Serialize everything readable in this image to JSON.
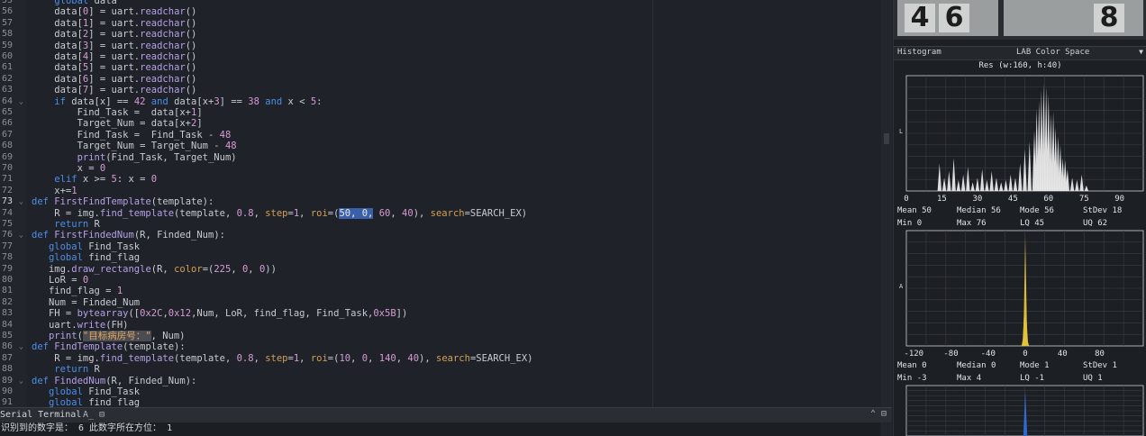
{
  "editor": {
    "current_line": "73",
    "lines": [
      {
        "n": "55",
        "fold": false,
        "html": "    <span class=\"kw\">global</span> data"
      },
      {
        "n": "56",
        "fold": false,
        "html": "    data[<span class=\"num\">0</span>] = uart.<span class=\"fn\">readchar</span>()"
      },
      {
        "n": "57",
        "fold": false,
        "html": "    data[<span class=\"num\">1</span>] = uart.<span class=\"fn\">readchar</span>()"
      },
      {
        "n": "58",
        "fold": false,
        "html": "    data[<span class=\"num\">2</span>] = uart.<span class=\"fn\">readchar</span>()"
      },
      {
        "n": "59",
        "fold": false,
        "html": "    data[<span class=\"num\">3</span>] = uart.<span class=\"fn\">readchar</span>()"
      },
      {
        "n": "60",
        "fold": false,
        "html": "    data[<span class=\"num\">4</span>] = uart.<span class=\"fn\">readchar</span>()"
      },
      {
        "n": "61",
        "fold": false,
        "html": "    data[<span class=\"num\">5</span>] = uart.<span class=\"fn\">readchar</span>()"
      },
      {
        "n": "62",
        "fold": false,
        "html": "    data[<span class=\"num\">6</span>] = uart.<span class=\"fn\">readchar</span>()"
      },
      {
        "n": "63",
        "fold": false,
        "html": "    data[<span class=\"num\">7</span>] = uart.<span class=\"fn\">readchar</span>()"
      },
      {
        "n": "64",
        "fold": true,
        "html": "    <span class=\"kw\">if</span> data[x] == <span class=\"num\">42</span> <span class=\"kw\">and</span> data[x+<span class=\"num\">3</span>] == <span class=\"num\">38</span> <span class=\"kw\">and</span> x &lt; <span class=\"num\">5</span>:"
      },
      {
        "n": "65",
        "fold": false,
        "html": "        Find_Task =  data[x+<span class=\"num\">1</span>]"
      },
      {
        "n": "66",
        "fold": false,
        "html": "        Target_Num = data[x+<span class=\"num\">2</span>]"
      },
      {
        "n": "67",
        "fold": false,
        "html": "        Find_Task =  Find_Task - <span class=\"num\">48</span>"
      },
      {
        "n": "68",
        "fold": false,
        "html": "        Target_Num = Target_Num - <span class=\"num\">48</span>"
      },
      {
        "n": "69",
        "fold": false,
        "html": "        <span class=\"fn\">print</span>(Find_Task, Target_Num)"
      },
      {
        "n": "70",
        "fold": false,
        "html": "        x = <span class=\"num\">0</span>"
      },
      {
        "n": "71",
        "fold": false,
        "html": "    <span class=\"kw\">elif</span> x &gt;= <span class=\"num\">5</span>: x = <span class=\"num\">0</span>"
      },
      {
        "n": "72",
        "fold": false,
        "html": "    x+=<span class=\"num\">1</span>"
      },
      {
        "n": "73",
        "fold": true,
        "html": "<span class=\"kw\">def</span> <span class=\"fn\">FirstFindTemplate</span>(template):"
      },
      {
        "n": "74",
        "fold": false,
        "html": "    R = img.<span class=\"fn\">find_template</span>(template, <span class=\"num\">0.8</span>, <span class=\"prm\">step</span>=<span class=\"num\">1</span>, <span class=\"prm\">roi</span>=(<span class=\"sel\">50, 0,</span> <span class=\"num\">60</span>, <span class=\"num\">40</span>), <span class=\"prm\">search</span>=SEARCH_EX)"
      },
      {
        "n": "75",
        "fold": false,
        "html": "    <span class=\"kw\">return</span> R"
      },
      {
        "n": "76",
        "fold": true,
        "html": "<span class=\"kw\">def</span> <span class=\"fn\">FirstFindedNum</span>(R, Finded_Num):"
      },
      {
        "n": "77",
        "fold": false,
        "html": "   <span class=\"kw\">global</span> Find_Task"
      },
      {
        "n": "78",
        "fold": false,
        "html": "   <span class=\"kw\">global</span> find_flag"
      },
      {
        "n": "79",
        "fold": false,
        "html": "   img.<span class=\"fn\">draw_rectangle</span>(R, <span class=\"prm\">color</span>=(<span class=\"num\">225</span>, <span class=\"num\">0</span>, <span class=\"num\">0</span>))"
      },
      {
        "n": "80",
        "fold": false,
        "html": "   LoR = <span class=\"num\">0</span>"
      },
      {
        "n": "81",
        "fold": false,
        "html": "   find_flag = <span class=\"num\">1</span>"
      },
      {
        "n": "82",
        "fold": false,
        "html": "   Num = Finded_Num"
      },
      {
        "n": "83",
        "fold": false,
        "html": "   FH = <span class=\"fn\">bytearray</span>([<span class=\"num\">0x2C</span>,<span class=\"num\">0x12</span>,Num, LoR, find_flag, Find_Task,<span class=\"num\">0x5B</span>])"
      },
      {
        "n": "84",
        "fold": false,
        "html": "   uart.<span class=\"fn\">write</span>(FH)"
      },
      {
        "n": "85",
        "fold": false,
        "html": "   <span class=\"fn\">print</span>(<span class=\"strsel\">\"目标病房号：\"</span>, Num)"
      },
      {
        "n": "86",
        "fold": true,
        "html": "<span class=\"kw\">def</span> <span class=\"fn\">FindTemplate</span>(template):"
      },
      {
        "n": "87",
        "fold": false,
        "html": "    R = img.<span class=\"fn\">find_template</span>(template, <span class=\"num\">0.8</span>, <span class=\"prm\">step</span>=<span class=\"num\">1</span>, <span class=\"prm\">roi</span>=(<span class=\"num\">10</span>, <span class=\"num\">0</span>, <span class=\"num\">140</span>, <span class=\"num\">40</span>), <span class=\"prm\">search</span>=SEARCH_EX)"
      },
      {
        "n": "88",
        "fold": false,
        "html": "    <span class=\"kw\">return</span> R"
      },
      {
        "n": "89",
        "fold": true,
        "html": "<span class=\"kw\">def</span> <span class=\"fn\">FindedNum</span>(R, Finded_Num):"
      },
      {
        "n": "90",
        "fold": false,
        "html": "   <span class=\"kw\">global</span> Find_Task"
      },
      {
        "n": "91",
        "fold": false,
        "html": "   <span class=\"kw\">global</span> find_flag"
      }
    ]
  },
  "serial": {
    "title": "Serial Terminal",
    "output": "识别到的数字是： 6 此数字所在方位： 1",
    "controls": "⌃ ⊟"
  },
  "framebuffer": {
    "digits": [
      "4",
      "6",
      "8"
    ]
  },
  "histogram": {
    "label": "Histogram",
    "color_space": "LAB Color Space",
    "resolution": "Res (w:160, h:40)",
    "channels": [
      {
        "name": "L",
        "axis_label": "L",
        "color": "#e8e8e8",
        "ticks": [
          "0",
          "15",
          "30",
          "45",
          "60",
          "75",
          "90"
        ],
        "x_range": [
          0,
          100
        ],
        "spikes": [
          [
            14,
            0.25
          ],
          [
            16,
            0.12
          ],
          [
            18,
            0.18
          ],
          [
            20,
            0.3
          ],
          [
            22,
            0.1
          ],
          [
            24,
            0.15
          ],
          [
            26,
            0.22
          ],
          [
            28,
            0.08
          ],
          [
            30,
            0.12
          ],
          [
            32,
            0.2
          ],
          [
            34,
            0.1
          ],
          [
            36,
            0.18
          ],
          [
            38,
            0.12
          ],
          [
            40,
            0.08
          ],
          [
            42,
            0.1
          ],
          [
            44,
            0.15
          ],
          [
            46,
            0.12
          ],
          [
            48,
            0.25
          ],
          [
            50,
            0.38
          ],
          [
            52,
            0.45
          ],
          [
            54,
            0.55
          ],
          [
            55,
            0.75
          ],
          [
            56,
            0.82
          ],
          [
            57,
            0.92
          ],
          [
            58,
            0.98
          ],
          [
            59,
            0.95
          ],
          [
            60,
            0.88
          ],
          [
            61,
            0.7
          ],
          [
            62,
            0.72
          ],
          [
            63,
            0.58
          ],
          [
            64,
            0.5
          ],
          [
            65,
            0.42
          ],
          [
            66,
            0.3
          ],
          [
            67,
            0.28
          ],
          [
            68,
            0.2
          ],
          [
            70,
            0.12
          ],
          [
            72,
            0.1
          ],
          [
            74,
            0.15
          ],
          [
            76,
            0.05
          ]
        ],
        "stats": {
          "Mean": "50",
          "Median": "56",
          "Mode": "56",
          "StDev": "18",
          "Min": "0",
          "Max": "76",
          "LQ": "45",
          "UQ": "62"
        }
      },
      {
        "name": "A",
        "axis_label": "A",
        "color": "#e3c23a",
        "ticks": [
          "-120",
          "-80",
          "-40",
          "0",
          "40",
          "80"
        ],
        "x_range": [
          -128,
          127
        ],
        "spikes": [
          [
            0,
            1.0
          ],
          [
            -1,
            0.35
          ],
          [
            1,
            0.3
          ],
          [
            -2,
            0.08
          ],
          [
            2,
            0.06
          ]
        ],
        "stats": {
          "Mean": "0",
          "Median": "0",
          "Mode": "1",
          "StDev": "1",
          "Min": "-3",
          "Max": "4",
          "LQ": "-1",
          "UQ": "1"
        }
      },
      {
        "name": "B",
        "axis_label": "",
        "color": "#2f6fd6",
        "ticks": [],
        "x_range": [
          -128,
          127
        ],
        "spikes": [
          [
            0,
            1.0
          ]
        ],
        "stats": {}
      }
    ]
  }
}
